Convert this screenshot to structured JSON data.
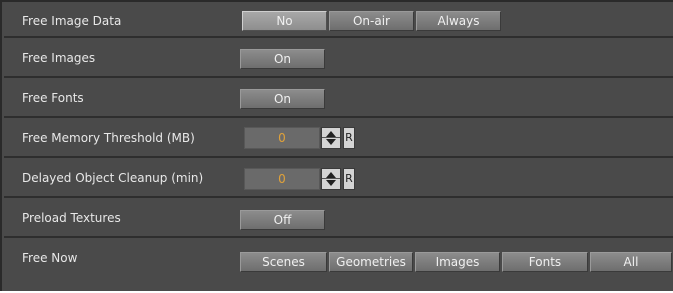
{
  "rows": [
    {
      "label": "Free Image Data",
      "buttons": [
        "No",
        "On-air",
        "Always"
      ],
      "selected": "No"
    },
    {
      "label": "Free Images",
      "buttons": [
        "On"
      ]
    },
    {
      "label": "Free Fonts",
      "buttons": [
        "On"
      ]
    },
    {
      "label": "Free Memory Threshold (MB)",
      "value": "0",
      "reset_label": "R"
    },
    {
      "label": "Delayed Object Cleanup (min)",
      "value": "0",
      "reset_label": "R"
    },
    {
      "label": "Preload Textures",
      "buttons": [
        "Off"
      ]
    },
    {
      "label": "Free Now",
      "buttons": [
        "Scenes",
        "Geometries",
        "Images",
        "Fonts",
        "All"
      ]
    }
  ]
}
